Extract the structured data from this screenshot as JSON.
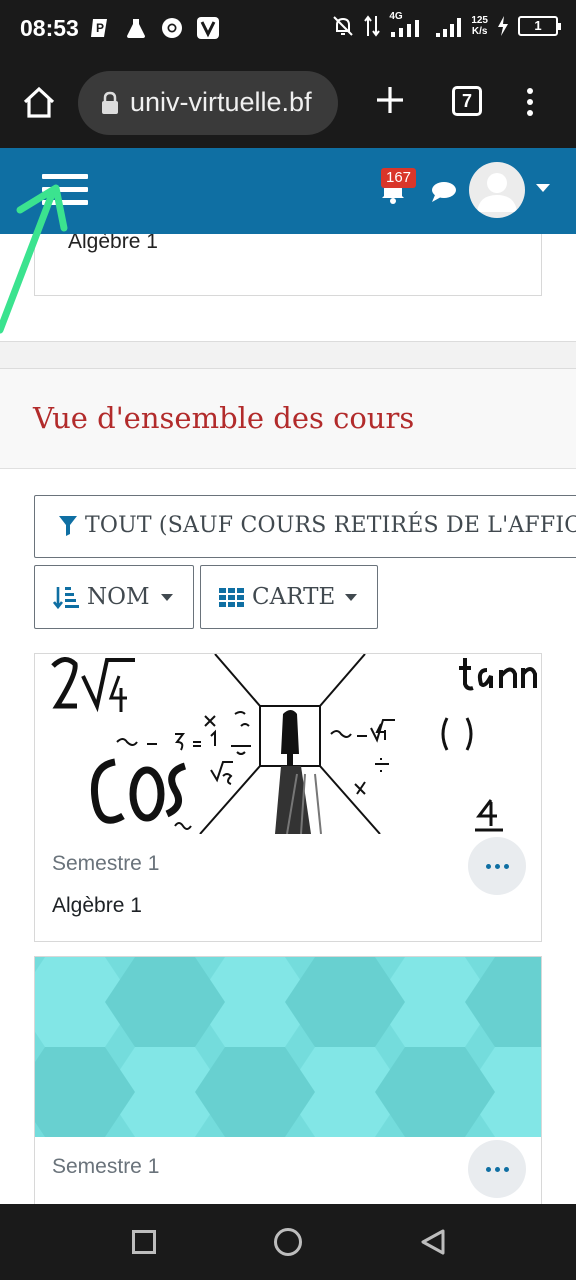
{
  "status_bar": {
    "time": "08:53",
    "network": "4G",
    "speed_value": "125",
    "speed_unit": "K/s",
    "battery": "1"
  },
  "browser": {
    "url": "univ-virtuelle.bf",
    "tab_count": "7"
  },
  "navbar": {
    "notification_count": "167",
    "colors": {
      "bar": "#0f6fa3",
      "badge": "#d9362a"
    }
  },
  "previous_card": {
    "course_name": "Algèbre 1"
  },
  "course_overview": {
    "title": "Vue d'ensemble des cours",
    "filter_label": "TOUT (SAUF COURS RETIRÉS DE L'AFFICHA",
    "sort_label": "NOM",
    "view_label": "CARTE",
    "courses": [
      {
        "category": "Semestre 1",
        "name": "Algèbre 1",
        "image": "math-sketch"
      },
      {
        "category": "Semestre 1",
        "name": "",
        "image": "hexagon-pattern"
      }
    ]
  },
  "icons": {
    "hamburger": "hamburger-icon",
    "bell": "bell-icon",
    "chat": "chat-icon",
    "filter": "filter-icon",
    "sort": "sort-icon",
    "grid": "grid-icon"
  }
}
